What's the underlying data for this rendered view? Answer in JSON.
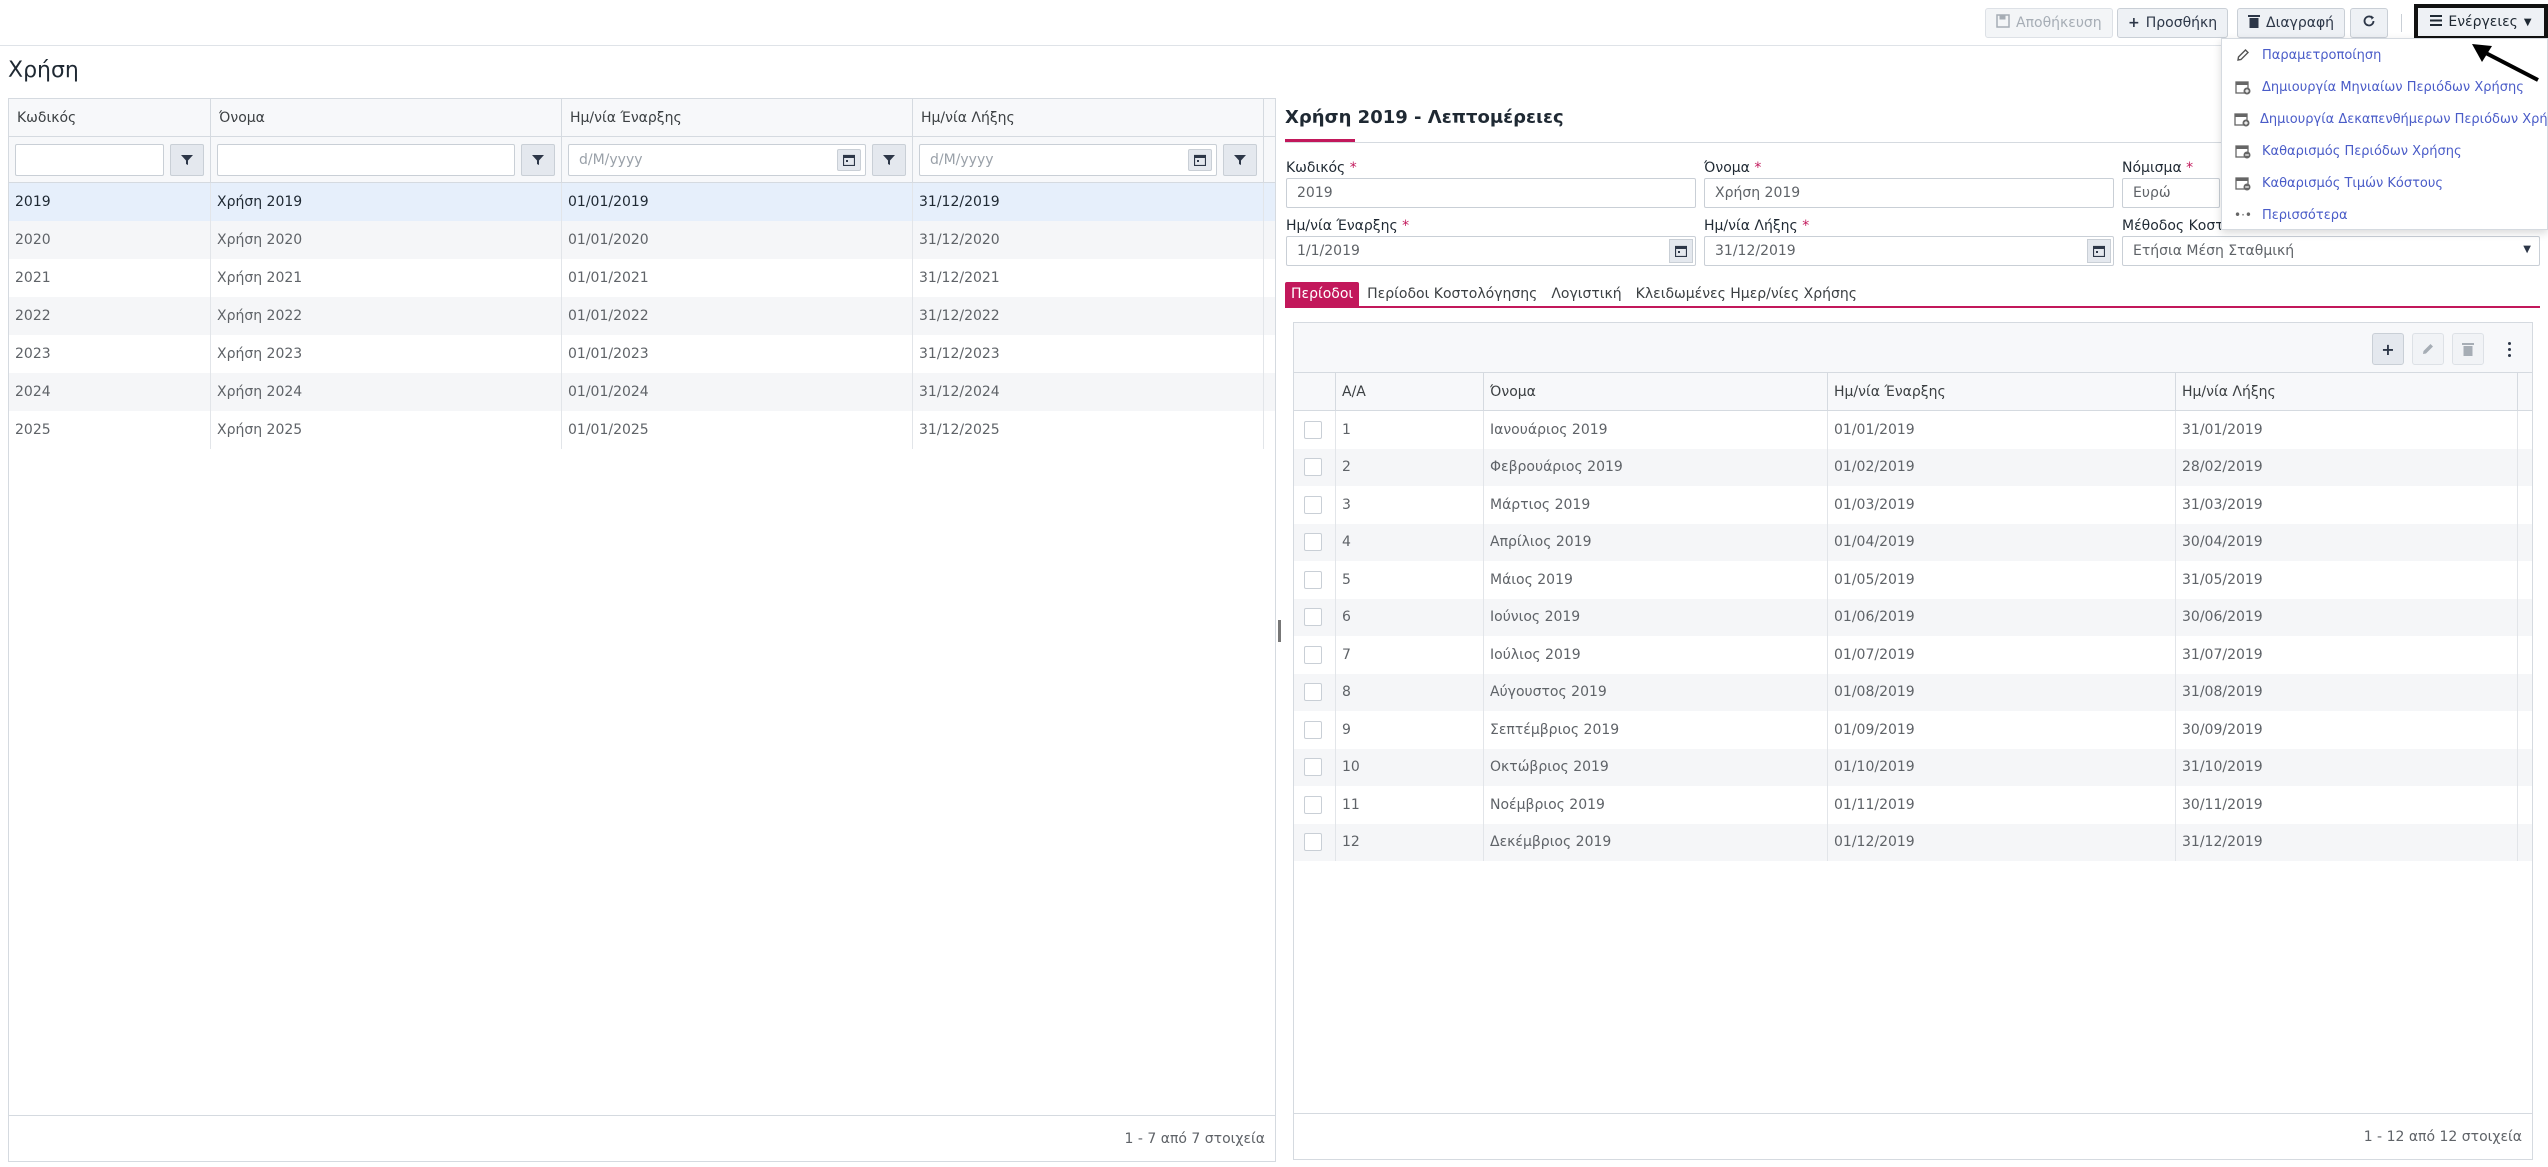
{
  "toolbar": {
    "save_label": "Αποθήκευση",
    "add_label": "Προσθήκη",
    "delete_label": "Διαγραφή",
    "actions_label": "Ενέργειες"
  },
  "actions_menu": [
    {
      "label": "Παραμετροποίηση",
      "icon": "pencil-icon"
    },
    {
      "label": "Δημιουργία Μηνιαίων Περιόδων Χρήσης",
      "icon": "calendar-add-icon"
    },
    {
      "label": "Δημιουργία Δεκαπενθήμερων Περιόδων Χρήσης",
      "icon": "calendar-add-icon"
    },
    {
      "label": "Καθαρισμός Περιόδων Χρήσης",
      "icon": "calendar-remove-icon"
    },
    {
      "label": "Καθαρισμός Τιμών Κόστους",
      "icon": "calendar-remove-icon"
    },
    {
      "label": "Περισσότερα",
      "icon": "more-icon"
    }
  ],
  "page_title": "Χρήση",
  "left_grid": {
    "columns": [
      "Κωδικός",
      "Όνομα",
      "Ημ/νία Έναρξης",
      "Ημ/νία Λήξης"
    ],
    "date_placeholder": "d/M/yyyy",
    "rows": [
      {
        "code": "2019",
        "name": "Χρήση 2019",
        "start": "01/01/2019",
        "end": "31/12/2019"
      },
      {
        "code": "2020",
        "name": "Χρήση 2020",
        "start": "01/01/2020",
        "end": "31/12/2020"
      },
      {
        "code": "2021",
        "name": "Χρήση 2021",
        "start": "01/01/2021",
        "end": "31/12/2021"
      },
      {
        "code": "2022",
        "name": "Χρήση 2022",
        "start": "01/01/2022",
        "end": "31/12/2022"
      },
      {
        "code": "2023",
        "name": "Χρήση 2023",
        "start": "01/01/2023",
        "end": "31/12/2023"
      },
      {
        "code": "2024",
        "name": "Χρήση 2024",
        "start": "01/01/2024",
        "end": "31/12/2024"
      },
      {
        "code": "2025",
        "name": "Χρήση 2025",
        "start": "01/01/2025",
        "end": "31/12/2025"
      }
    ],
    "footer": "1 - 7 από 7 στοιχεία"
  },
  "detail": {
    "title": "Χρήση 2019 - Λεπτομέρειες",
    "code_label": "Κωδικός",
    "code_value": "2019",
    "name_label": "Όνομα",
    "name_value": "Χρήση 2019",
    "currency_label": "Νόμισμα",
    "currency_value": "Ευρώ",
    "start_label": "Ημ/νία Έναρξης",
    "start_value": "1/1/2019",
    "end_label": "Ημ/νία Λήξης",
    "end_value": "31/12/2019",
    "method_label": "Μέθοδος Κοστ",
    "method_value": "Ετήσια Μέση Σταθμική",
    "tabs": [
      "Περίοδοι",
      "Περίοδοι Κοστολόγησης",
      "Λογιστική",
      "Κλειδωμένες Ημερ/νίες Χρήσης"
    ]
  },
  "periods": {
    "columns": [
      "Α/Α",
      "Όνομα",
      "Ημ/νία Έναρξης",
      "Ημ/νία Λήξης"
    ],
    "rows": [
      {
        "no": "1",
        "name": "Ιανουάριος 2019",
        "start": "01/01/2019",
        "end": "31/01/2019"
      },
      {
        "no": "2",
        "name": "Φεβρουάριος 2019",
        "start": "01/02/2019",
        "end": "28/02/2019"
      },
      {
        "no": "3",
        "name": "Μάρτιος 2019",
        "start": "01/03/2019",
        "end": "31/03/2019"
      },
      {
        "no": "4",
        "name": "Απρίλιος 2019",
        "start": "01/04/2019",
        "end": "30/04/2019"
      },
      {
        "no": "5",
        "name": "Μάιος 2019",
        "start": "01/05/2019",
        "end": "31/05/2019"
      },
      {
        "no": "6",
        "name": "Ιούνιος 2019",
        "start": "01/06/2019",
        "end": "30/06/2019"
      },
      {
        "no": "7",
        "name": "Ιούλιος 2019",
        "start": "01/07/2019",
        "end": "31/07/2019"
      },
      {
        "no": "8",
        "name": "Αύγουστος 2019",
        "start": "01/08/2019",
        "end": "31/08/2019"
      },
      {
        "no": "9",
        "name": "Σεπτέμβριος 2019",
        "start": "01/09/2019",
        "end": "30/09/2019"
      },
      {
        "no": "10",
        "name": "Οκτώβριος 2019",
        "start": "01/10/2019",
        "end": "31/10/2019"
      },
      {
        "no": "11",
        "name": "Νοέμβριος 2019",
        "start": "01/11/2019",
        "end": "30/11/2019"
      },
      {
        "no": "12",
        "name": "Δεκέμβριος 2019",
        "start": "01/12/2019",
        "end": "31/12/2019"
      }
    ],
    "footer": "1 - 12 από 12 στοιχεία"
  },
  "colors": {
    "accent": "#c2185b",
    "selected_row": "#e6effb",
    "menu_link": "#4a5cc8"
  }
}
